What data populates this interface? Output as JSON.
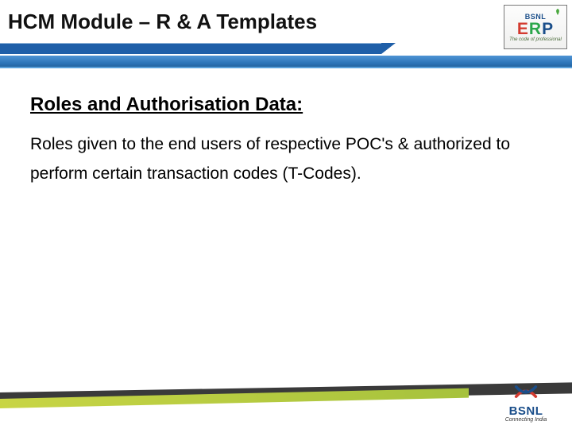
{
  "header": {
    "title": "HCM Module – R & A Templates"
  },
  "logos": {
    "erp_small": "BSNL",
    "erp_main": "ERP",
    "erp_tag": "The code of professional",
    "bsnl_name": "BSNL",
    "bsnl_tag": "Connecting India"
  },
  "content": {
    "section_heading": "Roles and Authorisation Data:",
    "body": "Roles given to the end users of respective POC's & authorized to perform certain transaction codes (T-Codes)."
  },
  "colors": {
    "band_blue": "#1f5fa8",
    "swoosh_green": "#b7cc40",
    "swoosh_dark": "#3a3a3a",
    "bsnl_blue": "#1a4e8a"
  }
}
